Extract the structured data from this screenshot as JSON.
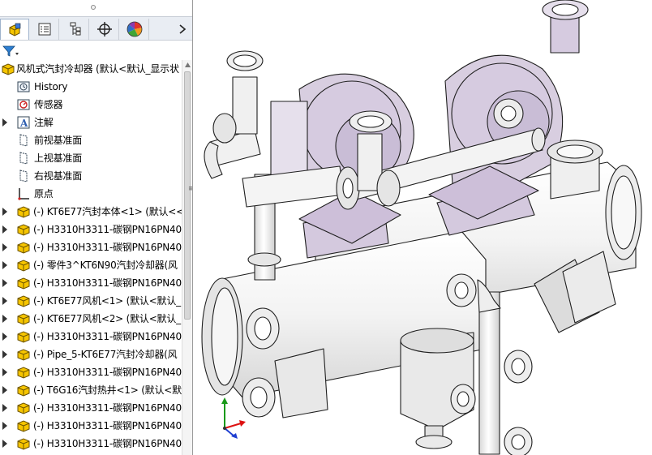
{
  "feature_tree": {
    "root": {
      "label": "风机式汽封冷却器 (默认<默认_显示状"
    },
    "system_items": [
      {
        "label": "History",
        "icon": "history-icon"
      },
      {
        "label": "传感器",
        "icon": "sensor-icon"
      },
      {
        "label": "注解",
        "icon": "annotation-icon"
      },
      {
        "label": "前视基准面",
        "icon": "plane-icon"
      },
      {
        "label": "上视基准面",
        "icon": "plane-icon"
      },
      {
        "label": "右视基准面",
        "icon": "plane-icon"
      },
      {
        "label": "原点",
        "icon": "origin-icon"
      }
    ],
    "components": [
      {
        "label": "(-) KT6E77汽封本体<1> (默认<<"
      },
      {
        "label": "(-) H3310H3311-碳钢PN16PN40"
      },
      {
        "label": "(-) H3310H3311-碳钢PN16PN40"
      },
      {
        "label": "(-) 零件3^KT6N90汽封冷却器(风"
      },
      {
        "label": "(-) H3310H3311-碳钢PN16PN40"
      },
      {
        "label": "(-) KT6E77风机<1> (默认<默认_"
      },
      {
        "label": "(-) KT6E77风机<2> (默认<默认_"
      },
      {
        "label": "(-) H3310H3311-碳钢PN16PN40"
      },
      {
        "label": "(-) Pipe_5-KT6E77汽封冷却器(风"
      },
      {
        "label": "(-) H3310H3311-碳钢PN16PN40"
      },
      {
        "label": "(-) T6G16汽封热井<1> (默认<默认"
      },
      {
        "label": "(-) H3310H3311-碳钢PN16PN40"
      },
      {
        "label": "(-) H3310H3311-碳钢PN16PN40"
      },
      {
        "label": "(-) H3310H3311-碳钢PN16PN40"
      }
    ]
  },
  "tabs": [
    {
      "name": "featuremanager-tab",
      "icon": "assembly-icon",
      "active": true
    },
    {
      "name": "propertymanager-tab",
      "icon": "property-list-icon",
      "active": false
    },
    {
      "name": "configurationmanager-tab",
      "icon": "configuration-icon",
      "active": false
    },
    {
      "name": "dimxpert-tab",
      "icon": "crosshair-icon",
      "active": false
    },
    {
      "name": "display-manager-tab",
      "icon": "color-wheel-icon",
      "active": false
    }
  ],
  "colors": {
    "accent": "#f0b400",
    "model_fill": "#d9d0e0",
    "model_face": "#c9bdd6",
    "model_edge": "#1f1f1f",
    "tree_blue": "#2f5fb0"
  }
}
